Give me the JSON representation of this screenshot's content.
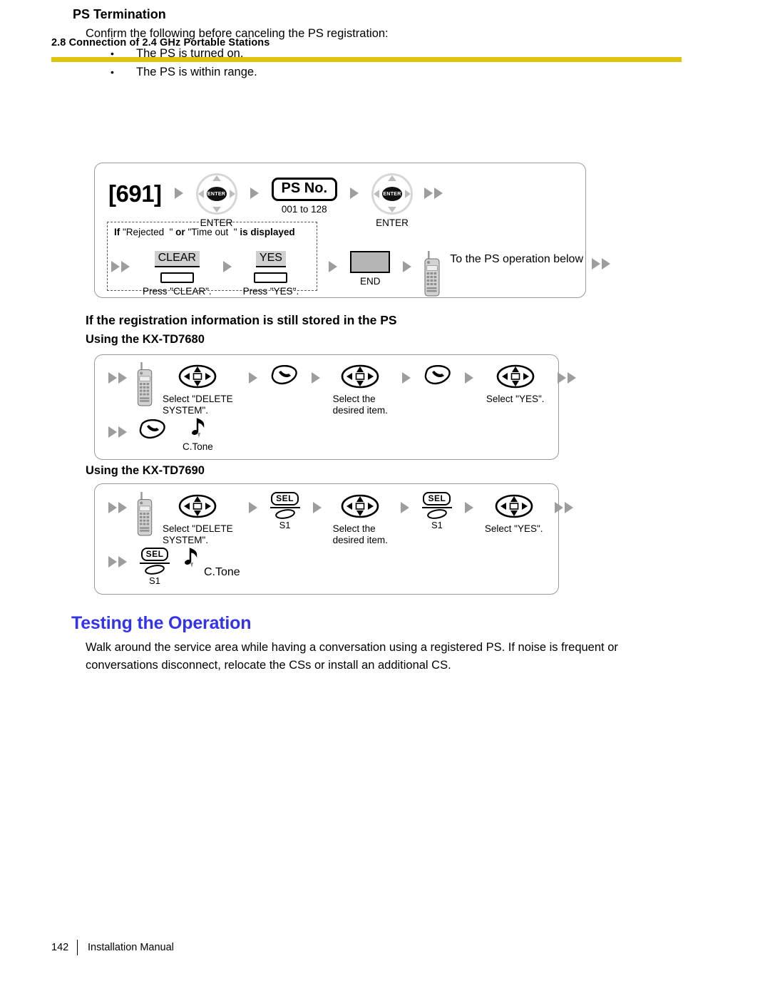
{
  "header": {
    "section_title": "2.8 Connection of 2.4 GHz Portable Stations",
    "rule_color": "#E0C30F"
  },
  "ps_termination": {
    "heading": "PS Termination",
    "lead": "Confirm the following before canceling the PS registration:",
    "bullets": [
      {
        "marker": "•",
        "text": "The PS is turned on."
      },
      {
        "marker": "•",
        "text": "The PS is within range."
      }
    ]
  },
  "diagram_691": {
    "code": "[691]",
    "enter1_label": "ENTER",
    "enter1_icon": "jog-dial-enter-icon",
    "ps_no_label": "PS No.",
    "ps_no_range": "001 to 128",
    "enter2_label": "ENTER",
    "enter2_icon": "jog-dial-enter-icon",
    "condition": {
      "if_word": "If",
      "q1_open": "\"Rejected",
      "q1_close": "\"",
      "or_word": "or",
      "q2_open": "\"Time out",
      "q2_close": "\"",
      "tail": "is displayed"
    },
    "clear_key_label": "CLEAR",
    "clear_caption": "Press \"CLEAR\".",
    "yes_key_label": "YES",
    "yes_caption": "Press \"YES\".",
    "end_label": "END",
    "end_icon": "end-key-icon",
    "handset_icon": "portable-station-icon",
    "to_ps_note": "To the PS\noperation\nbelow"
  },
  "still_stored": {
    "heading": "If the registration information is still stored in the PS",
    "subhead_7680": "Using the KX-TD7680",
    "subhead_7690": "Using the KX-TD7690"
  },
  "diagram_7680": {
    "handset_icon": "portable-station-icon",
    "steps": [
      {
        "icon": "navigator-key-icon",
        "caption": "Select \"DELETE\nSYSTEM\"."
      },
      {
        "icon": "talk-key-icon",
        "caption": ""
      },
      {
        "icon": "navigator-key-icon",
        "caption": "Select the\ndesired item."
      },
      {
        "icon": "talk-key-icon",
        "caption": ""
      },
      {
        "icon": "navigator-key-icon",
        "caption": "Select \"YES\"."
      }
    ],
    "row2": {
      "icon": "talk-key-icon",
      "tone_icon": "confirmation-tone-icon",
      "tone_label": "C.Tone"
    }
  },
  "diagram_7690": {
    "handset_icon": "portable-station-icon",
    "steps": [
      {
        "icon": "navigator-key-icon",
        "caption": "Select \"DELETE\nSYSTEM\"."
      },
      {
        "icon": "sel-key-icon",
        "key_label": "SEL",
        "sub_label": "S1",
        "caption": ""
      },
      {
        "icon": "navigator-key-icon",
        "caption": "Select the\ndesired item."
      },
      {
        "icon": "sel-key-icon",
        "key_label": "SEL",
        "sub_label": "S1",
        "caption": ""
      },
      {
        "icon": "navigator-key-icon",
        "caption": "Select \"YES\"."
      }
    ],
    "row2": {
      "icon": "sel-key-icon",
      "key_label": "SEL",
      "sub_label": "S1",
      "tone_icon": "confirmation-tone-icon",
      "tone_label": "C.Tone"
    }
  },
  "testing": {
    "heading": "Testing the Operation",
    "heading_color": "#3333EE",
    "paragraph": "Walk around the service area while having a conversation using a registered PS. If noise is frequent or conversations disconnect, relocate the CSs or install an additional CS."
  },
  "footer": {
    "page_number": "142",
    "manual_name": "Installation Manual"
  }
}
